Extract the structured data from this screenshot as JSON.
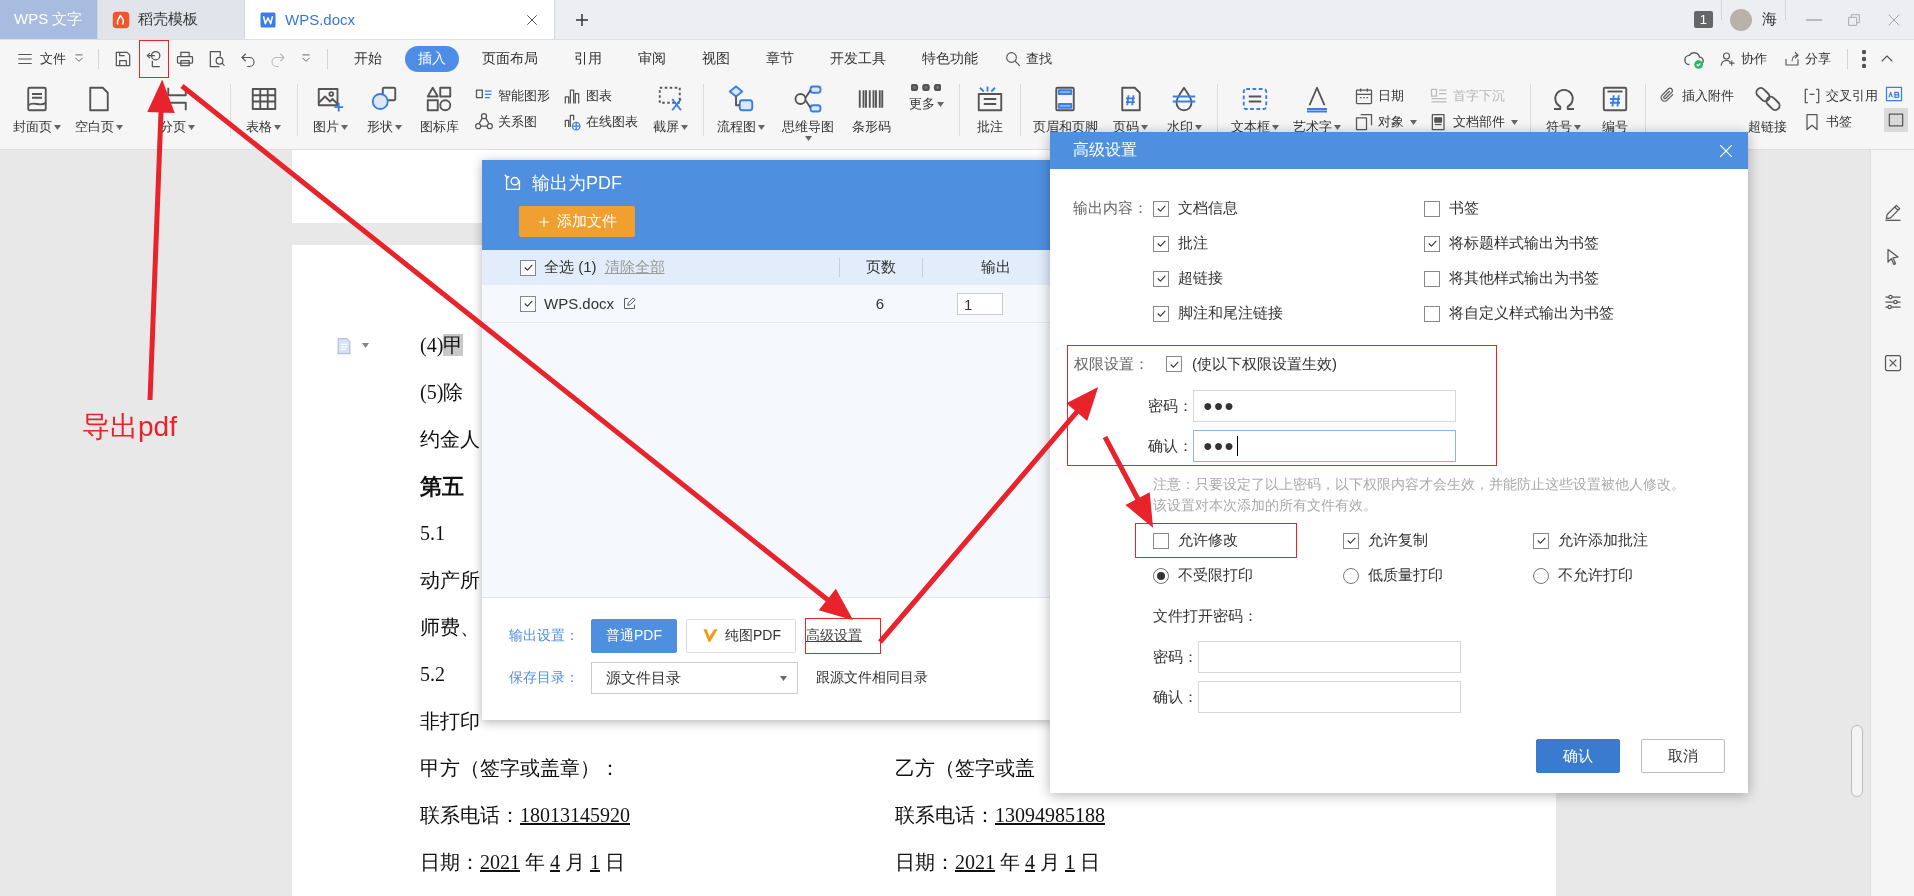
{
  "tabs": [
    {
      "label": "WPS 文字",
      "selected": false
    },
    {
      "label": "稻壳模板",
      "selected": false
    },
    {
      "label": "WPS.docx",
      "selected": true
    }
  ],
  "account": {
    "badge": "1",
    "user": "海"
  },
  "menu": {
    "file": "文件",
    "tabs": [
      {
        "label": "开始",
        "selected": false
      },
      {
        "label": "插入",
        "selected": true
      },
      {
        "label": "页面布局",
        "selected": false
      },
      {
        "label": "引用",
        "selected": false
      },
      {
        "label": "审阅",
        "selected": false
      },
      {
        "label": "视图",
        "selected": false
      },
      {
        "label": "章节",
        "selected": false
      },
      {
        "label": "开发工具",
        "selected": false
      },
      {
        "label": "特色功能",
        "selected": false
      }
    ],
    "search": "查找",
    "actions": [
      "协作",
      "分享"
    ]
  },
  "ribbon": [
    {
      "kind": "big",
      "label": "封面页",
      "dropdown": true
    },
    {
      "kind": "big",
      "label": "空白页",
      "dropdown": true
    },
    {
      "kind": "big",
      "label": "分页",
      "dropdown": true
    },
    {
      "kind": "separator"
    },
    {
      "kind": "big",
      "label": "表格",
      "dropdown": true
    },
    {
      "kind": "separator"
    },
    {
      "kind": "big",
      "label": "图片",
      "dropdown": true
    },
    {
      "kind": "big",
      "label": "形状",
      "dropdown": true
    },
    {
      "kind": "big",
      "label": "图标库",
      "dropdown": false
    },
    {
      "kind": "stack",
      "items": [
        {
          "label": "智能图形",
          "dropdown": false,
          "disabled": false
        },
        {
          "label": "关系图",
          "dropdown": false,
          "disabled": false
        }
      ]
    },
    {
      "kind": "stack",
      "items": [
        {
          "label": "图表",
          "dropdown": false,
          "disabled": false
        },
        {
          "label": "在线图表",
          "dropdown": false,
          "disabled": false
        }
      ]
    },
    {
      "kind": "big",
      "label": "截屏",
      "dropdown": true
    },
    {
      "kind": "separator"
    },
    {
      "kind": "big",
      "label": "流程图",
      "dropdown": true
    },
    {
      "kind": "big",
      "label": "思维导图",
      "dropdown": true
    },
    {
      "kind": "big",
      "label": "条形码",
      "dropdown": false
    },
    {
      "kind": "big",
      "label": "更多",
      "dropdown": true
    },
    {
      "kind": "separator"
    },
    {
      "kind": "big",
      "label": "批注",
      "dropdown": false
    },
    {
      "kind": "separator"
    },
    {
      "kind": "big",
      "label": "页眉和页脚",
      "dropdown": false
    },
    {
      "kind": "big",
      "label": "页码",
      "dropdown": true
    },
    {
      "kind": "big",
      "label": "水印",
      "dropdown": true
    },
    {
      "kind": "separator"
    },
    {
      "kind": "big",
      "label": "文本框",
      "dropdown": true
    },
    {
      "kind": "big",
      "label": "艺术字",
      "dropdown": true
    },
    {
      "kind": "stack",
      "items": [
        {
          "label": "日期",
          "dropdown": false,
          "disabled": false
        },
        {
          "label": "对象",
          "dropdown": true,
          "disabled": false
        }
      ]
    },
    {
      "kind": "stack",
      "items": [
        {
          "label": "首字下沉",
          "dropdown": false,
          "disabled": true
        },
        {
          "label": "文档部件",
          "dropdown": true,
          "disabled": false
        }
      ]
    },
    {
      "kind": "separator"
    },
    {
      "kind": "big",
      "label": "符号",
      "dropdown": true
    },
    {
      "kind": "big",
      "label": "编号",
      "dropdown": false
    },
    {
      "kind": "separator"
    },
    {
      "kind": "stack",
      "items": [
        {
          "label": "插入附件",
          "dropdown": false,
          "disabled": false
        }
      ]
    },
    {
      "kind": "big",
      "label": "超链接",
      "dropdown": false
    },
    {
      "kind": "stack",
      "items": [
        {
          "label": "交叉引用",
          "dropdown": false,
          "disabled": false
        },
        {
          "label": "书签",
          "dropdown": false,
          "disabled": false
        }
      ]
    }
  ],
  "document": {
    "lines": [
      {
        "kind": "text",
        "text": "(4)",
        "marked": "甲"
      },
      {
        "kind": "text",
        "text": "(5)除"
      },
      {
        "kind": "text",
        "text": "约金人"
      },
      {
        "kind": "heading",
        "text": "第五"
      },
      {
        "kind": "text",
        "text": "5.1"
      },
      {
        "kind": "text",
        "text": "动产所"
      },
      {
        "kind": "text",
        "text": "师费、"
      },
      {
        "kind": "text",
        "text": "5.2"
      },
      {
        "kind": "text",
        "text": "非打印"
      }
    ],
    "signatures": [
      {
        "party": "甲方（签字或盖章）：",
        "phone": [
          {
            "text": "联系电话：",
            "underline": false
          },
          {
            "text": "18013145920",
            "underline": true
          }
        ],
        "date": [
          {
            "text": "日期：",
            "underline": false
          },
          {
            "text": "2021",
            "underline": true
          },
          {
            "text": " 年 ",
            "underline": false
          },
          {
            "text": "4",
            "underline": true
          },
          {
            "text": " 月 ",
            "underline": false
          },
          {
            "text": "1",
            "underline": true
          },
          {
            "text": " 日",
            "underline": false
          }
        ]
      },
      {
        "party": "乙方（签字或盖",
        "phone": [
          {
            "text": "联系电话：",
            "underline": false
          },
          {
            "text": "13094985188",
            "underline": true
          }
        ],
        "date": [
          {
            "text": "日期：",
            "underline": false
          },
          {
            "text": "2021",
            "underline": true
          },
          {
            "text": " 年 ",
            "underline": false
          },
          {
            "text": "4",
            "underline": true
          },
          {
            "text": " 月 ",
            "underline": false
          },
          {
            "text": "1",
            "underline": true
          },
          {
            "text": " 日",
            "underline": false
          }
        ]
      }
    ]
  },
  "annotation": "导出pdf",
  "pdf_dialog": {
    "title": "输出为PDF",
    "add_button": "添加文件",
    "select_all": {
      "label": "全选 (1)",
      "checked": true
    },
    "clear_link": "清除全部",
    "columns": [
      "页数",
      "输出"
    ],
    "files": [
      {
        "name": "WPS.docx",
        "checked": true,
        "pages": "6",
        "from": "1"
      }
    ],
    "output_label": "输出设置：",
    "modes": [
      {
        "label": "普通PDF",
        "selected": true
      },
      {
        "label": "纯图PDF",
        "selected": false
      }
    ],
    "advanced_link": "高级设置",
    "save_label": "保存目录：",
    "save_value": "源文件目录",
    "save_note": "跟源文件相同目录"
  },
  "advanced_dialog": {
    "title": "高级设置",
    "content_label": "输出内容：",
    "content_options": [
      {
        "label": "文档信息",
        "checked": true
      },
      {
        "label": "书签",
        "checked": false
      },
      {
        "label": "批注",
        "checked": true
      },
      {
        "label": "将标题样式输出为书签",
        "checked": true
      },
      {
        "label": "超链接",
        "checked": true
      },
      {
        "label": "将其他样式输出为书签",
        "checked": false
      },
      {
        "label": "脚注和尾注链接",
        "checked": true
      },
      {
        "label": "将自定义样式输出为书签",
        "checked": false
      }
    ],
    "permission_label": "权限设置：",
    "permission": {
      "label": "(使以下权限设置生效)",
      "checked": true
    },
    "permission_fields": [
      {
        "label": "密码：",
        "value": "●●●",
        "focused": false
      },
      {
        "label": "确认：",
        "value": "●●●",
        "focused": true
      }
    ],
    "note": "注意：只要设定了以上密码，以下权限内容才会生效，并能防止这些设置被他人修改。该设置对本次添加的所有文件有效。",
    "allow_options": [
      {
        "label": "允许修改",
        "checked": false
      },
      {
        "label": "允许复制",
        "checked": true
      },
      {
        "label": "允许添加批注",
        "checked": true
      }
    ],
    "print_options": [
      {
        "label": "不受限打印",
        "selected": true
      },
      {
        "label": "低质量打印",
        "selected": false
      },
      {
        "label": "不允许打印",
        "selected": false
      }
    ],
    "open_password_label": "文件打开密码：",
    "open_fields": [
      {
        "label": "密码："
      },
      {
        "label": "确认："
      }
    ],
    "buttons": [
      {
        "label": "确认",
        "kind": "primary"
      },
      {
        "label": "取消",
        "kind": "secondary"
      }
    ]
  }
}
